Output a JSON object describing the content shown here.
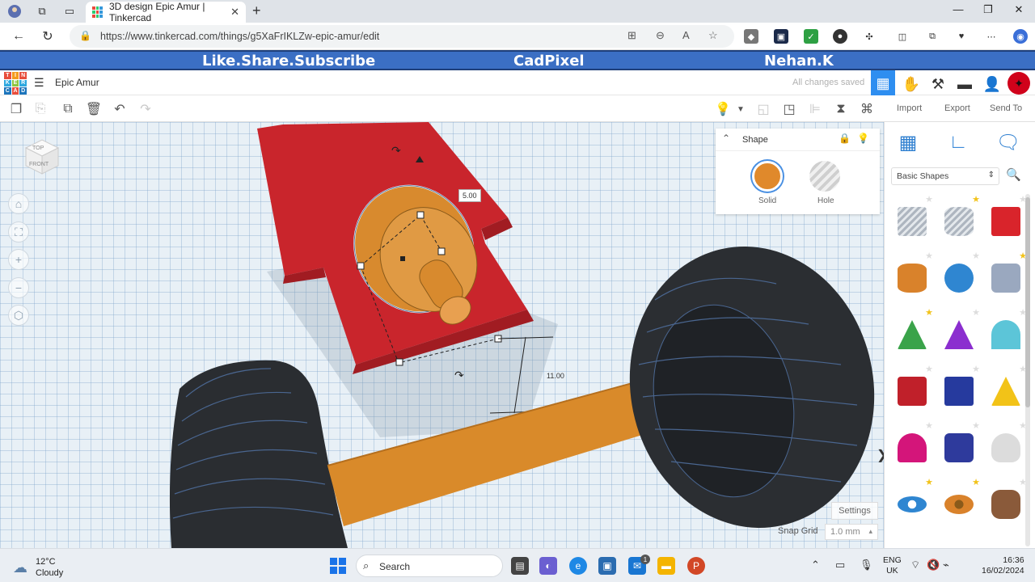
{
  "browser": {
    "tab_title": "3D design Epic Amur | Tinkercad",
    "url": "https://www.tinkercad.com/things/g5XaFrIKLZw-epic-amur/edit"
  },
  "banner": {
    "left": "Like.Share.Subscribe",
    "center": "CadPixel",
    "right": "Nehan.K"
  },
  "header": {
    "logo_letters": [
      "T",
      "I",
      "N",
      "K",
      "E",
      "R",
      "C",
      "A",
      "D"
    ],
    "design_title": "Epic Amur",
    "save_status": "All changes saved"
  },
  "toolbar": {
    "import_label": "Import",
    "export_label": "Export",
    "send_to_label": "Send To"
  },
  "viewcube": {
    "top": "TOP",
    "front": "FRONT"
  },
  "shape_panel": {
    "title": "Shape",
    "solid_label": "Solid",
    "hole_label": "Hole",
    "solid_color": "#e0892b"
  },
  "workplane": {
    "dim_top": "5.00",
    "dim_side": "11.00",
    "settings_label": "Settings",
    "snap_grid_label": "Snap Grid",
    "snap_grid_value": "1.0 mm"
  },
  "library": {
    "category": "Basic Shapes",
    "shapes": [
      {
        "name": "Box hole",
        "fav": false
      },
      {
        "name": "Cylinder hole",
        "fav": true
      },
      {
        "name": "Box",
        "fav": false
      },
      {
        "name": "Cylinder",
        "fav": false
      },
      {
        "name": "Sphere",
        "fav": false
      },
      {
        "name": "Scribble",
        "fav": true
      },
      {
        "name": "Roof",
        "fav": true
      },
      {
        "name": "Cone",
        "fav": false
      },
      {
        "name": "Round roof",
        "fav": false
      },
      {
        "name": "Text",
        "fav": false
      },
      {
        "name": "Polygon",
        "fav": false
      },
      {
        "name": "Pyramid",
        "fav": false
      },
      {
        "name": "Half sphere",
        "fav": false
      },
      {
        "name": "Hexagonal prism",
        "fav": false
      },
      {
        "name": "Paraboloid",
        "fav": false
      },
      {
        "name": "Torus",
        "fav": true
      },
      {
        "name": "Tube",
        "fav": true
      },
      {
        "name": "Shape generator",
        "fav": false
      }
    ]
  },
  "taskbar": {
    "temp": "12°C",
    "weather": "Cloudy",
    "search": "Search",
    "lang1": "ENG",
    "lang2": "UK",
    "time": "16:36",
    "date": "16/02/2024",
    "notif_count": "1"
  }
}
